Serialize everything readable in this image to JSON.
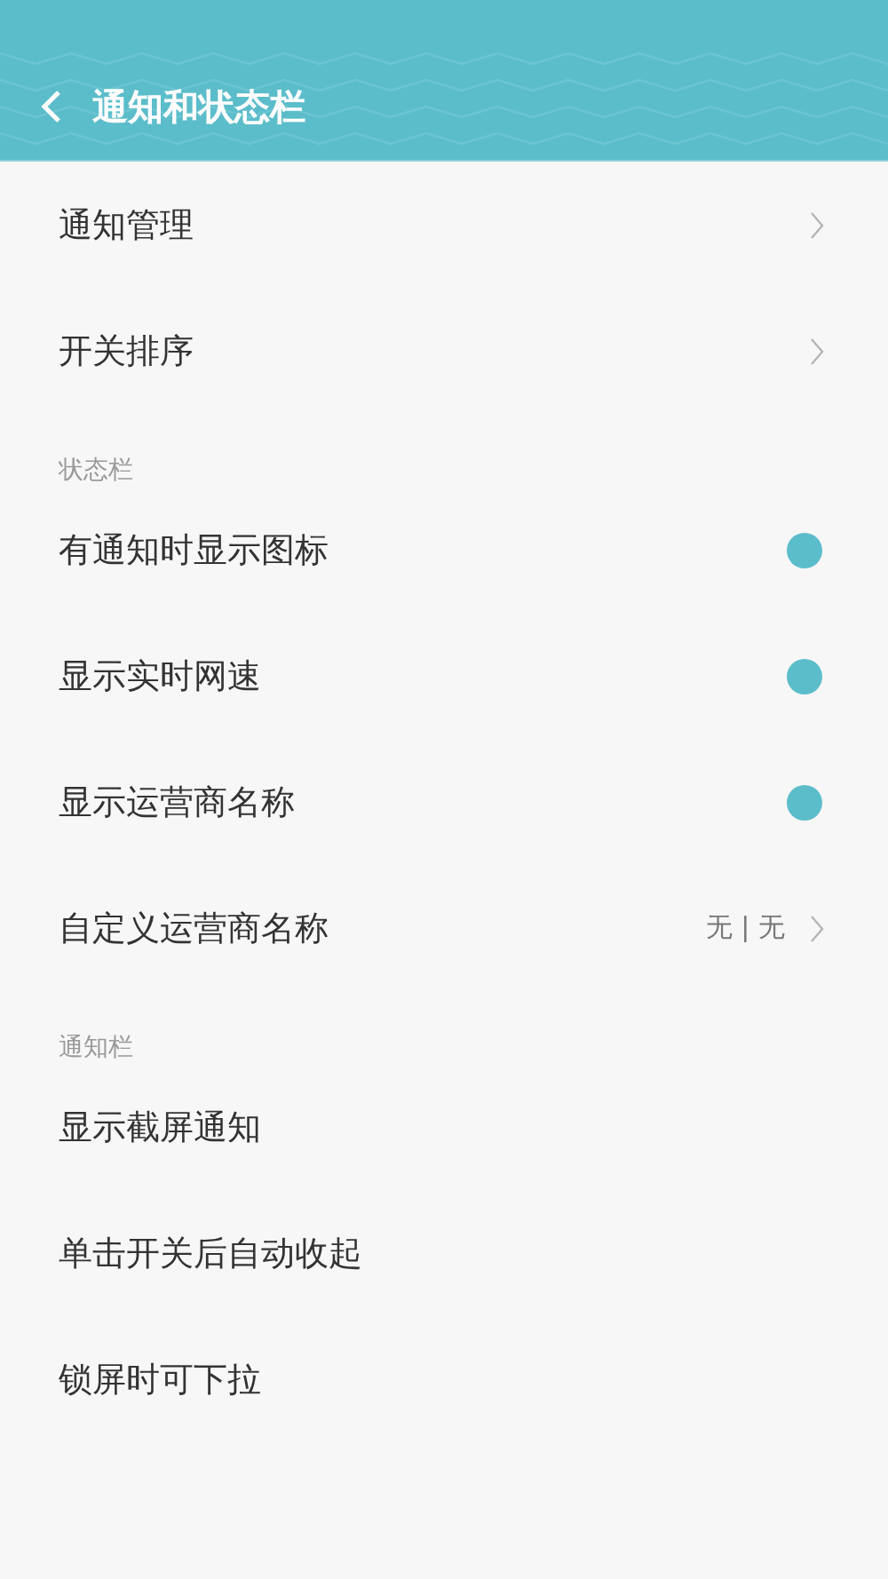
{
  "header": {
    "title": "通知和状态栏"
  },
  "sections": [
    {
      "items": [
        {
          "kind": "link",
          "label": "通知管理"
        },
        {
          "kind": "link",
          "label": "开关排序"
        }
      ]
    },
    {
      "title": "状态栏",
      "items": [
        {
          "kind": "toggle",
          "label": "有通知时显示图标",
          "on": true
        },
        {
          "kind": "toggle",
          "label": "显示实时网速",
          "on": true
        },
        {
          "kind": "toggle",
          "label": "显示运营商名称",
          "on": true
        },
        {
          "kind": "link",
          "label": "自定义运营商名称",
          "value": "无 | 无"
        }
      ]
    },
    {
      "title": "通知栏",
      "items": [
        {
          "kind": "plain",
          "label": "显示截屏通知"
        },
        {
          "kind": "plain",
          "label": "单击开关后自动收起"
        },
        {
          "kind": "plain",
          "label": "锁屏时可下拉"
        }
      ]
    }
  ]
}
